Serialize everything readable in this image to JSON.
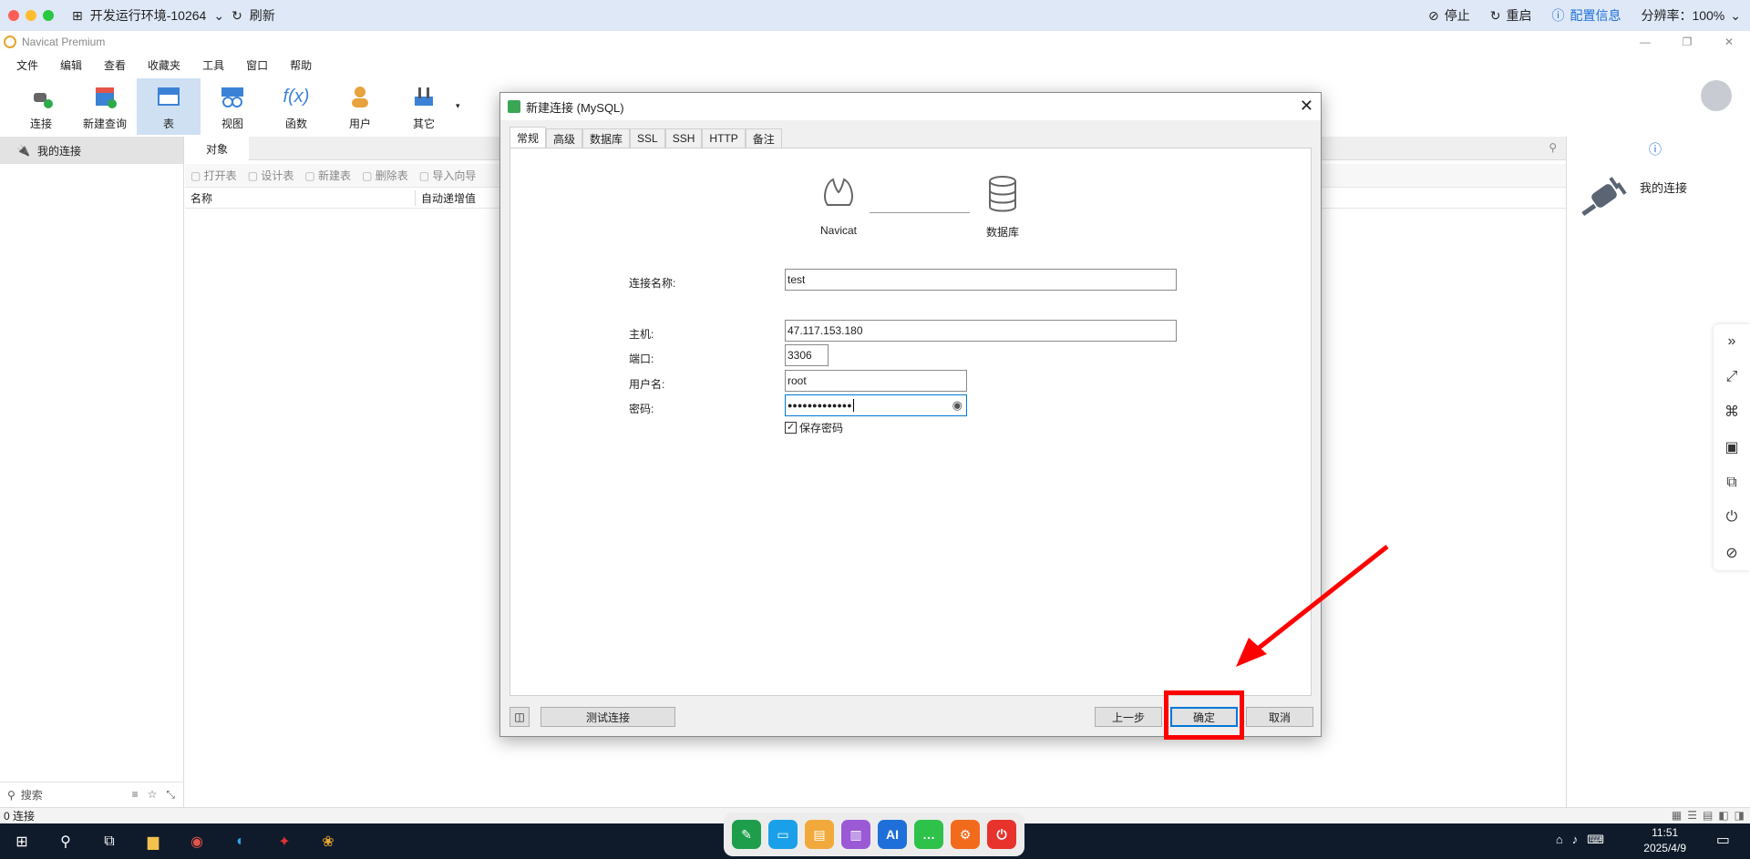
{
  "remote_bar": {
    "env_name": "开发运行环境-10264",
    "refresh": "刷新",
    "stop": "停止",
    "restart": "重启",
    "config": "配置信息",
    "resolution": "分辨率：100%"
  },
  "app": {
    "title": "Navicat Premium",
    "menu": [
      "文件",
      "编辑",
      "查看",
      "收藏夹",
      "工具",
      "窗口",
      "帮助"
    ],
    "toolbar": [
      "连接",
      "新建查询",
      "表",
      "视图",
      "函数",
      "用户",
      "其它"
    ],
    "left_header": "我的连接",
    "left_search": "搜索",
    "tab_objects": "对象",
    "obj_actions": [
      "打开表",
      "设计表",
      "新建表",
      "删除表",
      "导入向导"
    ],
    "columns": [
      "名称",
      "自动递增值"
    ],
    "right_label": "我的连接",
    "status": "0 连接"
  },
  "dialog": {
    "title": "新建连接 (MySQL)",
    "tabs": [
      "常规",
      "高级",
      "数据库",
      "SSL",
      "SSH",
      "HTTP",
      "备注"
    ],
    "diagram_left": "Navicat",
    "diagram_right": "数据库",
    "fields": {
      "conn_name_label": "连接名称:",
      "conn_name_value": "test",
      "host_label": "主机:",
      "host_value": "47.117.153.180",
      "port_label": "端口:",
      "port_value": "3306",
      "user_label": "用户名:",
      "user_value": "root",
      "pwd_label": "密码:",
      "pwd_value": "●●●●●●●●●●●●●",
      "save_pwd": "保存密码"
    },
    "buttons": {
      "test": "测试连接",
      "prev": "上一步",
      "ok": "确定",
      "cancel": "取消"
    }
  },
  "taskbar": {
    "time": "11:51",
    "date": "2025/4/9",
    "dock_ai": "AI"
  }
}
